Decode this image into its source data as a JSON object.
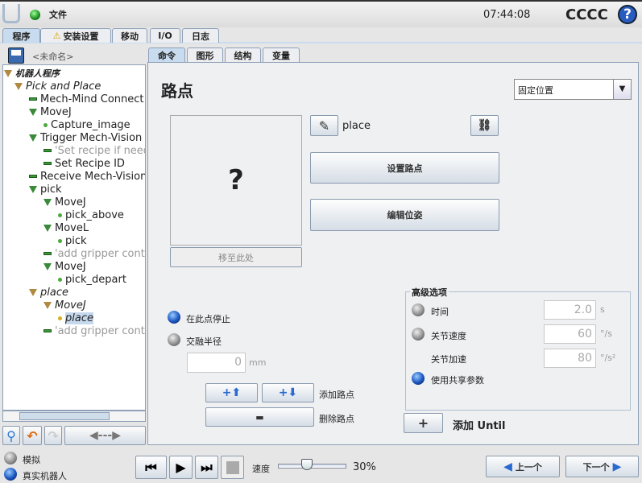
{
  "header": {
    "file_menu": "文件",
    "time": "07:44:08",
    "robot_name": "CCCC",
    "help": "?"
  },
  "main_tabs": [
    {
      "label": "程序",
      "active": true
    },
    {
      "label": "安装设置",
      "warning": true
    },
    {
      "label": "移动"
    },
    {
      "label": "I/O"
    },
    {
      "label": "日志"
    }
  ],
  "program": {
    "name": "<未命名>"
  },
  "tree": [
    {
      "label": "机器人程序",
      "level": 0,
      "icon": "triangle-tan",
      "style": "root"
    },
    {
      "label": "Pick and Place",
      "level": 1,
      "icon": "triangle-tan",
      "style": "italic"
    },
    {
      "label": "Mech-Mind Connect",
      "level": 2,
      "icon": "dash"
    },
    {
      "label": "MoveJ",
      "level": 2,
      "icon": "triangle"
    },
    {
      "label": "Capture_image",
      "level": 3,
      "icon": "dot"
    },
    {
      "label": "Trigger Mech-Vision",
      "level": 2,
      "icon": "triangle"
    },
    {
      "label": "'Set recipe if need",
      "level": 3,
      "icon": "dash",
      "style": "comment"
    },
    {
      "label": "Set Recipe ID",
      "level": 3,
      "icon": "dash"
    },
    {
      "label": "Receive Mech-Vision",
      "level": 2,
      "icon": "dash"
    },
    {
      "label": "pick",
      "level": 2,
      "icon": "triangle"
    },
    {
      "label": "MoveJ",
      "level": 3,
      "icon": "triangle"
    },
    {
      "label": "pick_above",
      "level": 4,
      "icon": "dot"
    },
    {
      "label": "MoveL",
      "level": 3,
      "icon": "triangle"
    },
    {
      "label": "pick",
      "level": 4,
      "icon": "dot"
    },
    {
      "label": "'add gripper contr",
      "level": 3,
      "icon": "dash",
      "style": "comment"
    },
    {
      "label": "MoveJ",
      "level": 3,
      "icon": "triangle"
    },
    {
      "label": "pick_depart",
      "level": 4,
      "icon": "dot"
    },
    {
      "label": "place",
      "level": 2,
      "icon": "triangle-tan",
      "style": "italic"
    },
    {
      "label": "MoveJ",
      "level": 3,
      "icon": "triangle-tan",
      "style": "italic"
    },
    {
      "label": "place",
      "level": 4,
      "icon": "dot-yellow",
      "style": "selected"
    },
    {
      "label": "'add gripper contr",
      "level": 3,
      "icon": "dash",
      "style": "comment"
    }
  ],
  "sub_tabs": [
    {
      "label": "命令",
      "active": true
    },
    {
      "label": "图形"
    },
    {
      "label": "结构"
    },
    {
      "label": "变量"
    }
  ],
  "waypoint": {
    "title": "路点",
    "position_type": "固定位置",
    "name": "place",
    "image_placeholder": "?",
    "move_here": "移至此处",
    "set_waypoint": "设置路点",
    "edit_pose": "编辑位姿",
    "stop_at_point": "在此点停止",
    "blend_radius": "交融半径",
    "blend_value": "0",
    "blend_unit": "mm",
    "stop_selected": true,
    "add_waypoint": "添加路点",
    "remove_waypoint": "删除路点",
    "advanced": {
      "title": "高级选项",
      "time_label": "时间",
      "time_value": "2.0",
      "time_unit": "s",
      "joint_speed_label": "关节速度",
      "joint_speed_value": "60",
      "joint_speed_unit": "°/s",
      "joint_accel_label": "关节加速",
      "joint_accel_value": "80",
      "joint_accel_unit": "°/s²",
      "shared_label": "使用共享参数",
      "selected": "shared"
    },
    "add_until": "添加 Until"
  },
  "footer": {
    "simulation": "模拟",
    "real_robot": "真实机器人",
    "mode": "real_robot",
    "speed_label": "速度",
    "speed_value": "30%",
    "speed_fraction": 0.3,
    "prev": "上一个",
    "next": "下一个"
  }
}
